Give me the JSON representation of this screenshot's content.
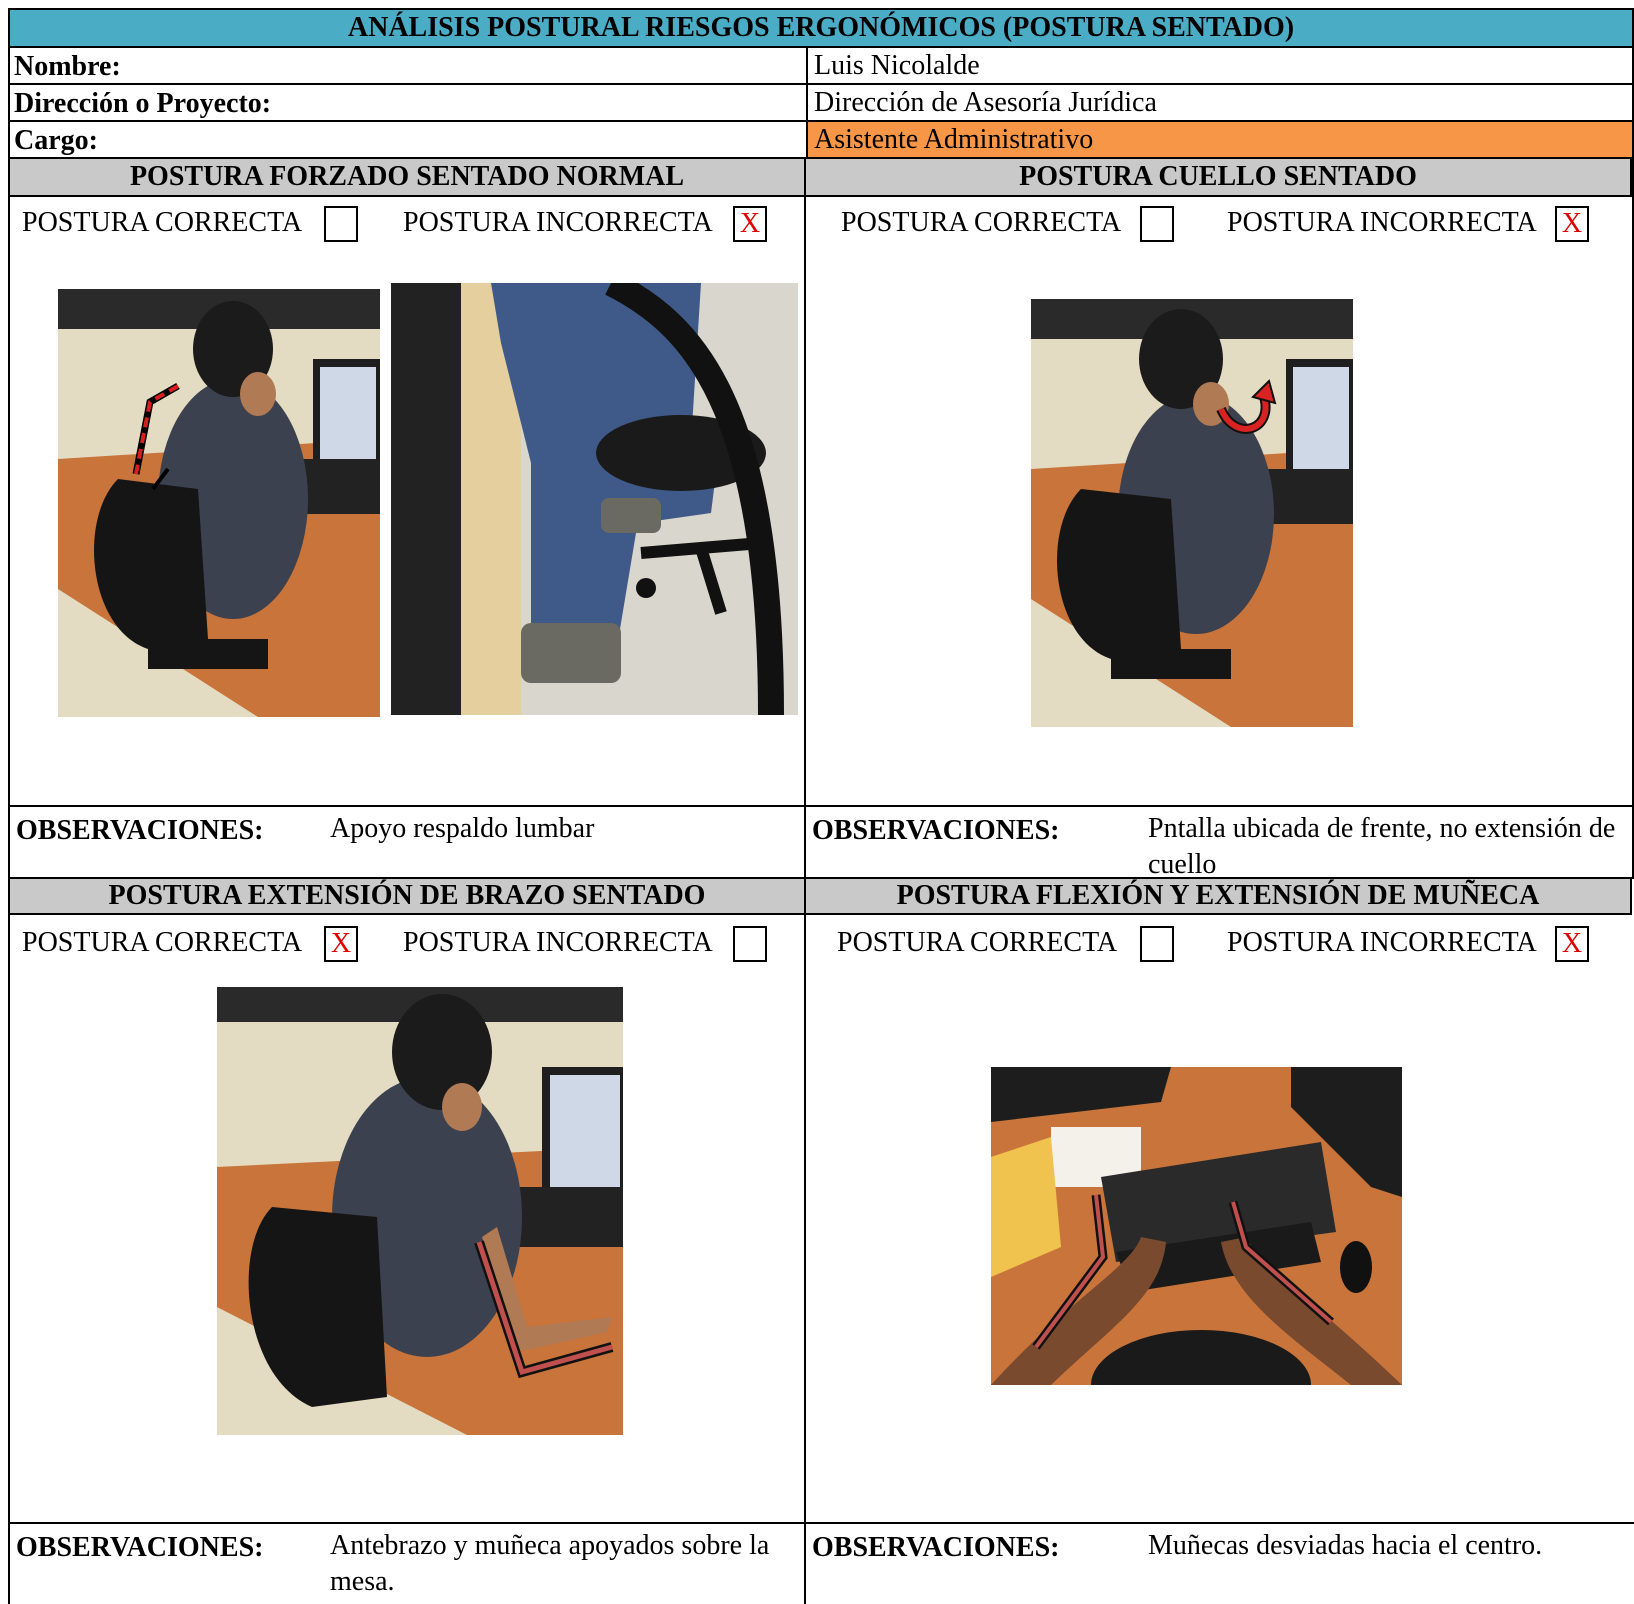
{
  "title": "ANÁLISIS POSTURAL RIESGOS ERGONÓMICOS (POSTURA SENTADO)",
  "fields": {
    "nombre_label": "Nombre:",
    "nombre_value": "Luis Nicolalde",
    "direccion_label": "Dirección o Proyecto:",
    "direccion_value": "Dirección de Asesoría Jurídica",
    "cargo_label": "Cargo:",
    "cargo_value": "Asistente Administrativo",
    "cargo_highlight": "#f79646"
  },
  "colors": {
    "title_bg": "#4bacc6",
    "section_bg": "#c9c9c9",
    "mark": "#e00000"
  },
  "correct_label": "POSTURA CORRECTA",
  "incorrect_label": "POSTURA INCORRECTA",
  "obs_label": "OBSERVACIONES:",
  "sections": [
    {
      "title": "POSTURA FORZADO SENTADO NORMAL",
      "correct_mark": "",
      "incorrect_mark": "X",
      "observation": "Apoyo respaldo lumbar"
    },
    {
      "title": "POSTURA CUELLO SENTADO",
      "correct_mark": "",
      "incorrect_mark": "X",
      "observation": "Pntalla ubicada de frente, no extensión de cuello"
    },
    {
      "title": "POSTURA EXTENSIÓN DE BRAZO SENTADO",
      "correct_mark": "X",
      "incorrect_mark": "",
      "observation": "Antebrazo y muñeca apoyados sobre la mesa."
    },
    {
      "title": "POSTURA FLEXIÓN Y EXTENSIÓN DE MUÑECA",
      "correct_mark": "",
      "incorrect_mark": "X",
      "observation": "Muñecas desviadas hacia el centro."
    }
  ]
}
